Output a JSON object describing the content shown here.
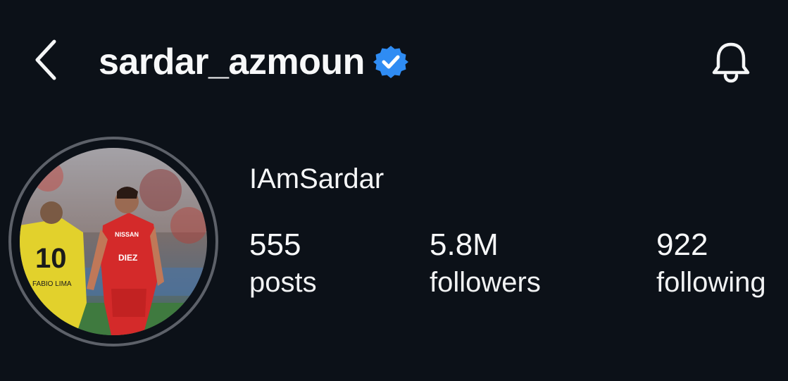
{
  "header": {
    "back_icon": "chevron-left-icon",
    "username": "sardar_azmoun",
    "verified_icon": "verified-badge-icon",
    "notifications_icon": "bell-icon"
  },
  "profile": {
    "display_name": "IAmSardar",
    "avatar": {
      "jersey_left_number": "10",
      "jersey_left_name": "FABIO LIMA",
      "jersey_right_sponsor": "NISSAN",
      "jersey_right_sponsor2": "DIEZ"
    }
  },
  "stats": [
    {
      "value": "555",
      "label": "posts"
    },
    {
      "value": "5.8M",
      "label": "followers"
    },
    {
      "value": "922",
      "label": "following"
    }
  ],
  "colors": {
    "background": "#0c1118",
    "text": "#f5f6f7",
    "verified": "#2f8cf3",
    "avatar_ring": "#5d6169"
  }
}
